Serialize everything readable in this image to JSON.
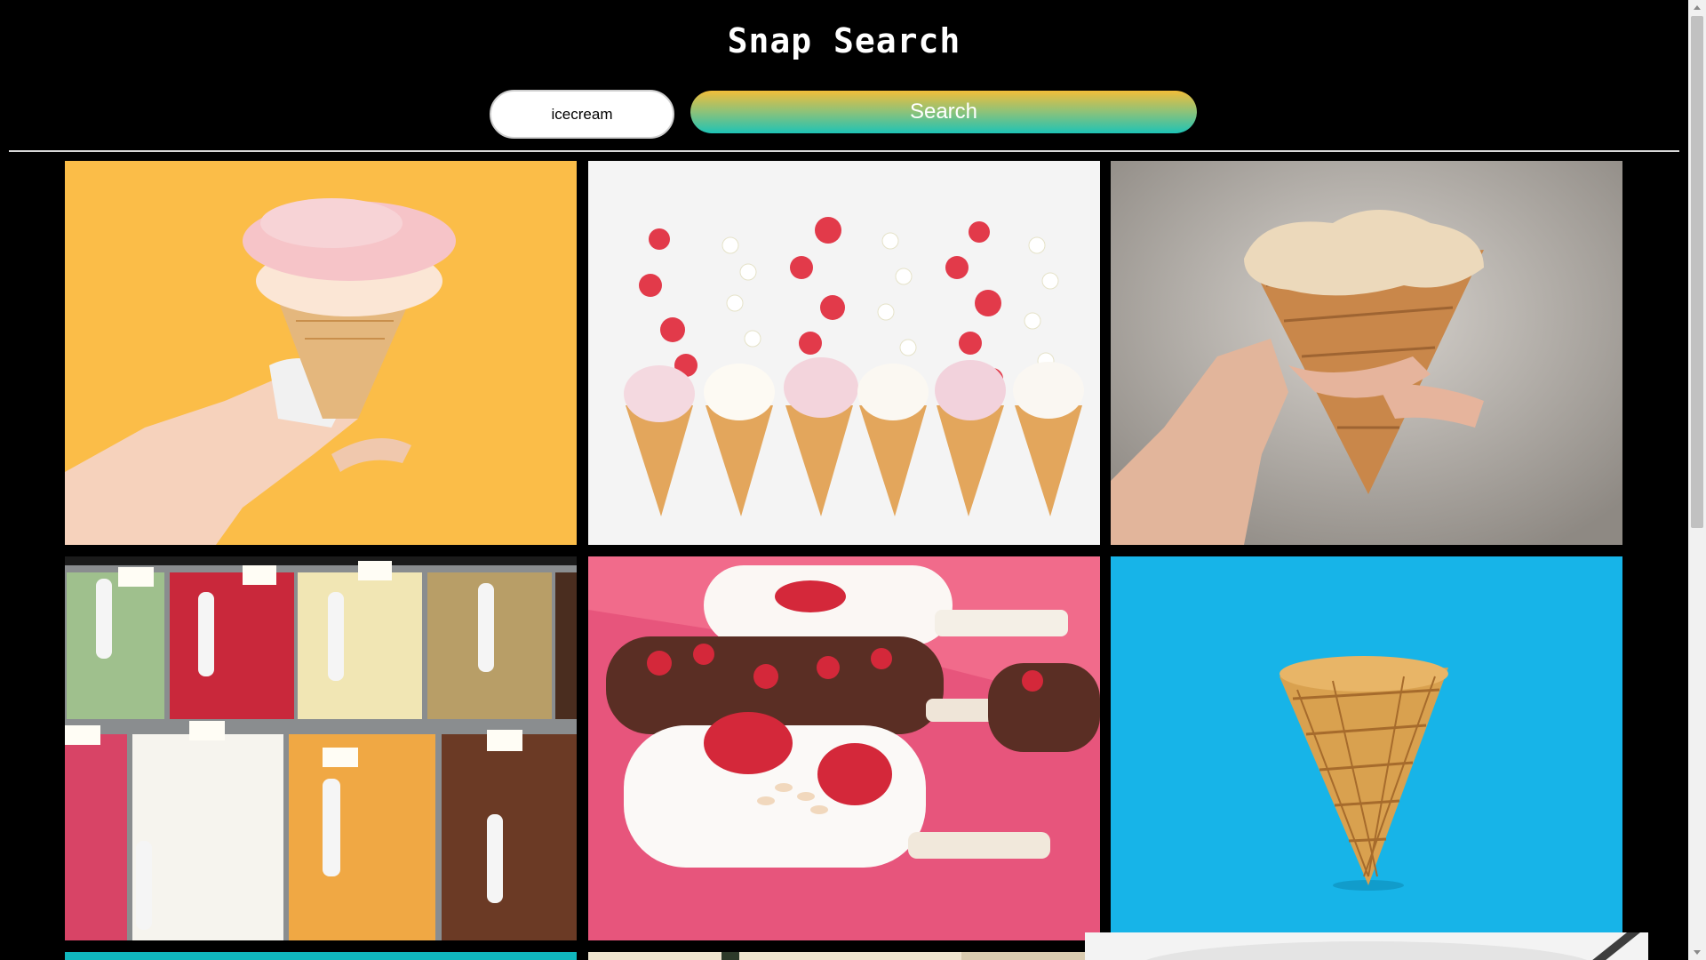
{
  "app": {
    "title": "Snap Search"
  },
  "search": {
    "value": "icecream",
    "button_label": "Search"
  },
  "colors": {
    "background": "#000000",
    "title_text": "#ffffff",
    "button_gradient_top": "#f2bd3a",
    "button_gradient_bottom": "#1ec3b6"
  },
  "results": [
    {
      "subject": "hand holding pink ice cream cone",
      "icon": "image-icon"
    },
    {
      "subject": "strawberries and flowers above six ice cream cones",
      "icon": "image-icon"
    },
    {
      "subject": "hand holding melting caramel ice cream cone",
      "icon": "image-icon"
    },
    {
      "subject": "gelato display case",
      "icon": "image-icon"
    },
    {
      "subject": "popsicles with strawberries",
      "icon": "image-icon"
    },
    {
      "subject": "empty waffle cone on blue",
      "icon": "image-icon"
    },
    {
      "subject": "partial result (teal)",
      "icon": "image-icon"
    },
    {
      "subject": "partial result (cream)",
      "icon": "image-icon"
    },
    {
      "subject": "partial result (white)",
      "icon": "image-icon"
    }
  ]
}
